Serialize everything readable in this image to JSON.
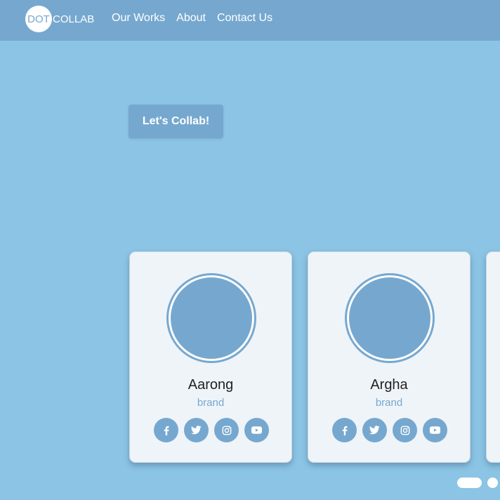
{
  "brand": {
    "dot": "DOT",
    "name": "COLLAB"
  },
  "nav": {
    "links": [
      {
        "label": "Our Works"
      },
      {
        "label": "About"
      },
      {
        "label": "Contact Us"
      }
    ]
  },
  "hero": {
    "cta_label": "Let's Collab!"
  },
  "cards": [
    {
      "name": "Aarong",
      "role": "brand",
      "socials": [
        "facebook-icon",
        "twitter-icon",
        "instagram-icon",
        "youtube-icon"
      ]
    },
    {
      "name": "Argha",
      "role": "brand",
      "socials": [
        "facebook-icon",
        "twitter-icon",
        "instagram-icon",
        "youtube-icon"
      ]
    }
  ],
  "carousel": {
    "active_index": 0,
    "slide_count": 2
  },
  "colors": {
    "accent": "#76a8cf",
    "background": "#8bc4e4",
    "card": "#eff4f9",
    "text": "#222222"
  }
}
